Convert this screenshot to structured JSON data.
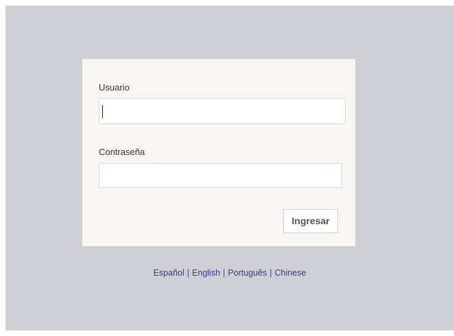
{
  "login": {
    "username_label": "Usuario",
    "username_value": "",
    "password_label": "Contraseña",
    "password_value": "",
    "submit_label": "Ingresar"
  },
  "languages": [
    {
      "label": "Español"
    },
    {
      "label": "English"
    },
    {
      "label": "Português"
    },
    {
      "label": "Chinese"
    }
  ],
  "separator": "|",
  "colors": {
    "background": "#ced0d6",
    "panel": "#f7f6f2",
    "link": "#2e3d8f"
  }
}
